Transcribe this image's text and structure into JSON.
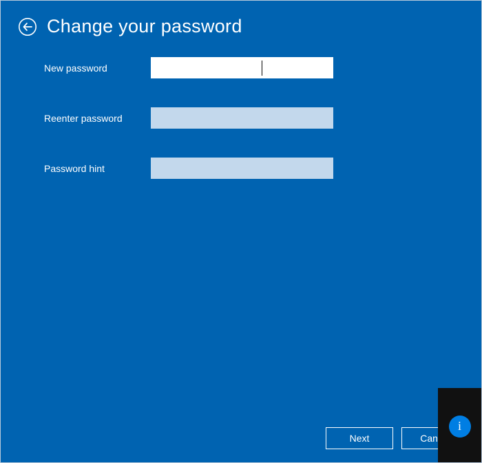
{
  "header": {
    "title": "Change your password"
  },
  "form": {
    "new_password": {
      "label": "New password",
      "value": ""
    },
    "reenter_password": {
      "label": "Reenter password",
      "value": ""
    },
    "password_hint": {
      "label": "Password hint",
      "value": ""
    }
  },
  "footer": {
    "next_label": "Next",
    "cancel_label": "Cancel"
  },
  "info": {
    "glyph": "i"
  }
}
